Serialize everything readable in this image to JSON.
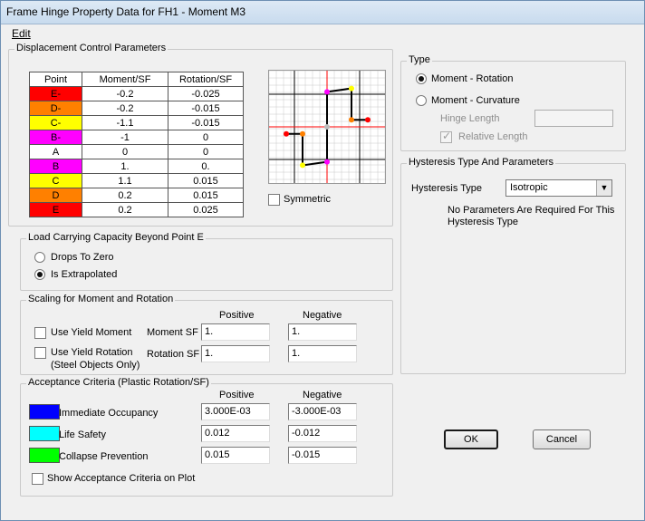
{
  "window": {
    "title": "Frame Hinge Property Data for FH1 - Moment M3"
  },
  "menu": {
    "edit": "Edit"
  },
  "displacement": {
    "title": "Displacement Control Parameters",
    "headers": [
      "Point",
      "Moment/SF",
      "Rotation/SF"
    ],
    "rows": [
      {
        "point": "E-",
        "moment": "-0.2",
        "rotation": "-0.025",
        "color": "#ff0000"
      },
      {
        "point": "D-",
        "moment": "-0.2",
        "rotation": "-0.015",
        "color": "#ff8000"
      },
      {
        "point": "C-",
        "moment": "-1.1",
        "rotation": "-0.015",
        "color": "#ffff00"
      },
      {
        "point": "B-",
        "moment": "-1",
        "rotation": "0",
        "color": "#ff00ff"
      },
      {
        "point": "A",
        "moment": "0",
        "rotation": "0",
        "color": "#ffffff"
      },
      {
        "point": "B",
        "moment": "1.",
        "rotation": "0.",
        "color": "#ff00ff"
      },
      {
        "point": "C",
        "moment": "1.1",
        "rotation": "0.015",
        "color": "#ffff00"
      },
      {
        "point": "D",
        "moment": "0.2",
        "rotation": "0.015",
        "color": "#ff8000"
      },
      {
        "point": "E",
        "moment": "0.2",
        "rotation": "0.025",
        "color": "#ff0000"
      }
    ],
    "symmetric_label": "Symmetric"
  },
  "type": {
    "title": "Type",
    "moment_rotation": "Moment - Rotation",
    "moment_curvature": "Moment - Curvature",
    "hinge_length": "Hinge Length",
    "relative_length": "Relative Length"
  },
  "hysteresis": {
    "title": "Hysteresis Type And Parameters",
    "label": "Hysteresis Type",
    "selected": "Isotropic",
    "note_line1": "No Parameters Are Required For This",
    "note_line2": "Hysteresis Type"
  },
  "load_carrying": {
    "title": "Load Carrying Capacity Beyond Point E",
    "drops": "Drops To Zero",
    "extrapolated": "Is Extrapolated"
  },
  "scaling": {
    "title": "Scaling for Moment and Rotation",
    "positive": "Positive",
    "negative": "Negative",
    "use_yield_moment": "Use Yield Moment",
    "use_yield_rotation": "Use Yield Rotation",
    "steel_only": "(Steel Objects Only)",
    "moment_sf": "Moment SF",
    "rotation_sf": "Rotation SF",
    "moment_pos": "1.",
    "moment_neg": "1.",
    "rotation_pos": "1.",
    "rotation_neg": "1."
  },
  "acceptance": {
    "title": "Acceptance Criteria (Plastic Rotation/SF)",
    "positive": "Positive",
    "negative": "Negative",
    "criteria": [
      {
        "label": "Immediate Occupancy",
        "color": "#0000ff",
        "pos": "3.000E-03",
        "neg": "-3.000E-03"
      },
      {
        "label": "Life Safety",
        "color": "#00ffff",
        "pos": "0.012",
        "neg": "-0.012"
      },
      {
        "label": "Collapse Prevention",
        "color": "#00ff00",
        "pos": "0.015",
        "neg": "-0.015"
      }
    ],
    "show_on_plot": "Show Acceptance Criteria on Plot"
  },
  "buttons": {
    "ok": "OK",
    "cancel": "Cancel"
  },
  "plot_colors": {
    "grid": "#c8c8c8",
    "axis": "#ff0000",
    "curve": "#000000"
  }
}
